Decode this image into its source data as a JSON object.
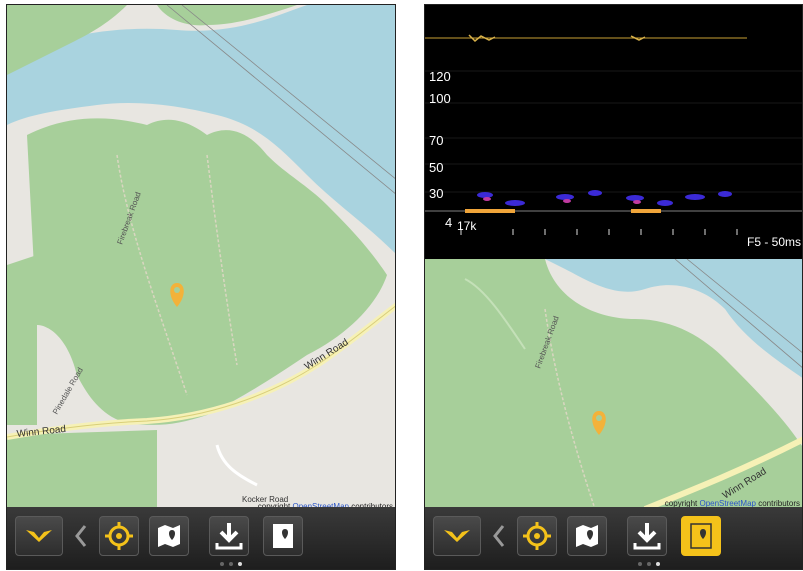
{
  "map": {
    "labels": {
      "firebreak": "Firebreak Road",
      "pinedale": "Pinedale Road",
      "winn_east": "Winn Road",
      "winn_west": "Winn Road",
      "kocker": "Kocker Road"
    },
    "copyright_prefix": "copyright ",
    "copyright_link": "OpenStreetMap",
    "copyright_suffix": " contributors"
  },
  "spectrogram": {
    "y_ticks": [
      "120",
      "100",
      "70",
      "50",
      "30",
      "4"
    ],
    "frequency": "17k",
    "setting": "F5 - 50ms"
  },
  "toolbar": {
    "buttons": [
      "logo",
      "back",
      "locate",
      "map",
      "download",
      "layers"
    ]
  },
  "colors": {
    "water": "#a9d3df",
    "forest": "#a7cf9a",
    "road": "#f6f1b6",
    "accent": "#f4c21a",
    "marker": "#f3b23a"
  }
}
